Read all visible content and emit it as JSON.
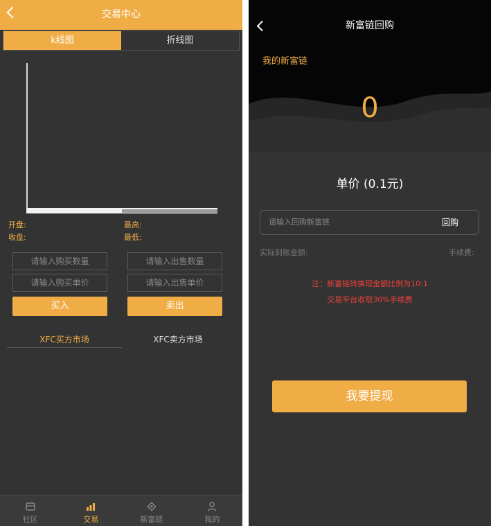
{
  "left": {
    "header": {
      "title": "交易中心"
    },
    "tabs": [
      {
        "label": "k线图",
        "active": true
      },
      {
        "label": "折线图",
        "active": false
      }
    ],
    "stats": {
      "open": "开盘:",
      "close": "收盘:",
      "high": "最高:",
      "low": "最低:"
    },
    "buy": {
      "qty_placeholder": "请输入购买数量",
      "price_placeholder": "请输入购买单价",
      "button": "买入"
    },
    "sell": {
      "qty_placeholder": "请输入出售数量",
      "price_placeholder": "请输入出售单价",
      "button": "卖出"
    },
    "markets": {
      "buy_market": "XFC买方市场",
      "sell_market": "XFC卖方市场"
    },
    "nav": [
      {
        "label": "社区",
        "icon": "community-icon",
        "active": false
      },
      {
        "label": "交易",
        "icon": "chart-bar-icon",
        "active": true
      },
      {
        "label": "新富链",
        "icon": "chain-icon",
        "active": false
      },
      {
        "label": "我的",
        "icon": "user-icon",
        "active": false
      }
    ]
  },
  "right": {
    "header": {
      "title": "新富链回购"
    },
    "balance_label": "我的新富链",
    "balance_value": "0",
    "price": "单价 (0.1元)",
    "input": {
      "placeholder": "请输入回购新富链",
      "action": "回购"
    },
    "actual_amount_label": "实际到账金额:",
    "fee_label": "手续费:",
    "notes": [
      "注：新富链转换现金额比例为10:1",
      "交易平台收取30%手续费"
    ],
    "withdraw_button": "我要提现"
  },
  "colors": {
    "accent": "#f0ad45",
    "background": "#333333",
    "warning": "#e8403a"
  }
}
